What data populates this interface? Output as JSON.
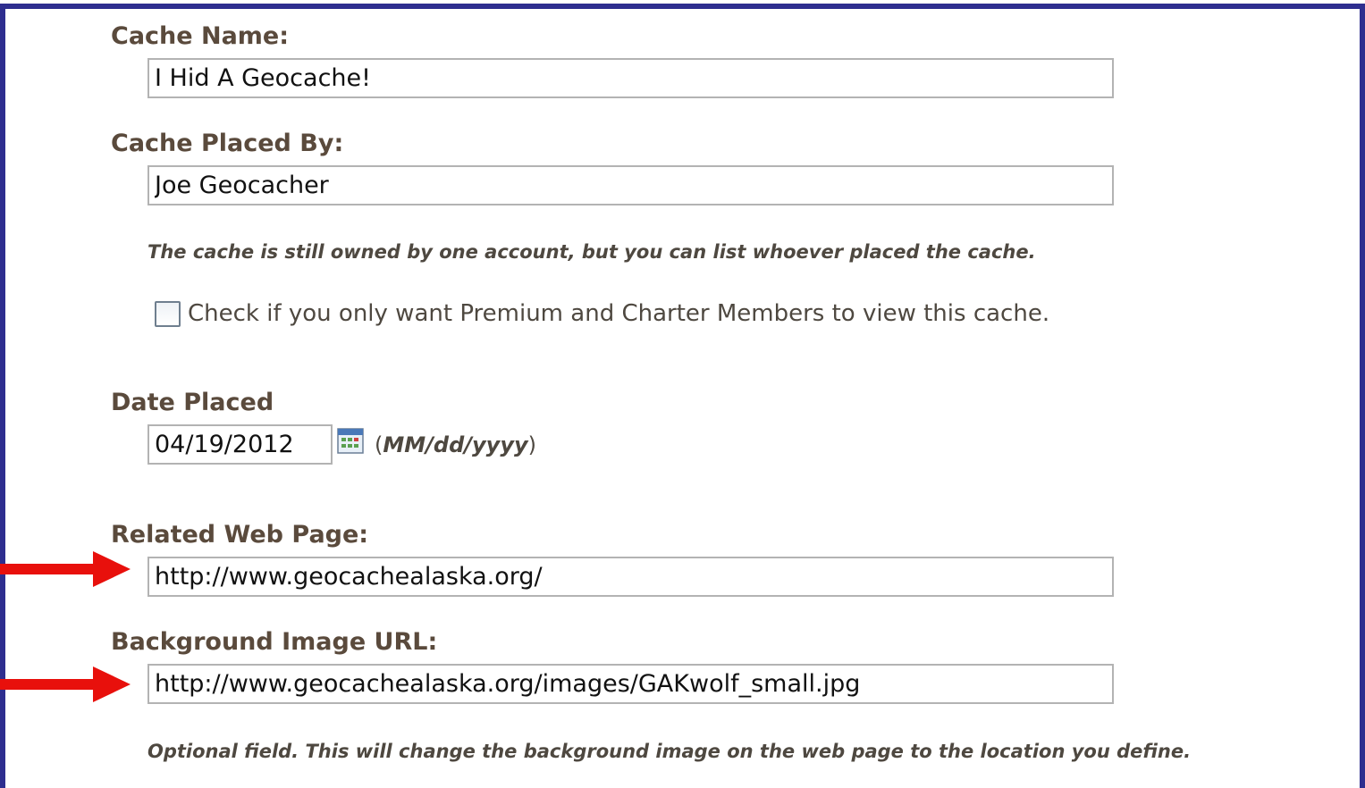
{
  "form": {
    "cache_name": {
      "label": "Cache Name:",
      "value": "I Hid A Geocache!"
    },
    "placed_by": {
      "label": "Cache Placed By:",
      "value": "Joe Geocacher",
      "note": "The cache is still owned by one account, but you can list whoever placed the cache."
    },
    "premium": {
      "label": "Check if you only want Premium and Charter Members to view this cache.",
      "checked": false
    },
    "date_placed": {
      "label": "Date Placed",
      "value": "04/19/2012",
      "format_open": "(",
      "format": "MM/dd/yyyy",
      "format_close": ")",
      "icon": "calendar-icon"
    },
    "related_web_page": {
      "label": "Related Web Page:",
      "value": "http://www.geocachealaska.org/"
    },
    "background_image": {
      "label": "Background Image URL:",
      "value": "http://www.geocachealaska.org/images/GAKwolf_small.jpg",
      "note": "Optional field. This will change the background image on the web page to the location you define."
    }
  },
  "annotations": {
    "arrow_color": "#e8100c",
    "arrow_icon": "arrow-right-icon"
  },
  "colors": {
    "frame_border": "#2e2e8f",
    "label_text": "#5a4a3c",
    "input_border": "#b3b3b3"
  }
}
